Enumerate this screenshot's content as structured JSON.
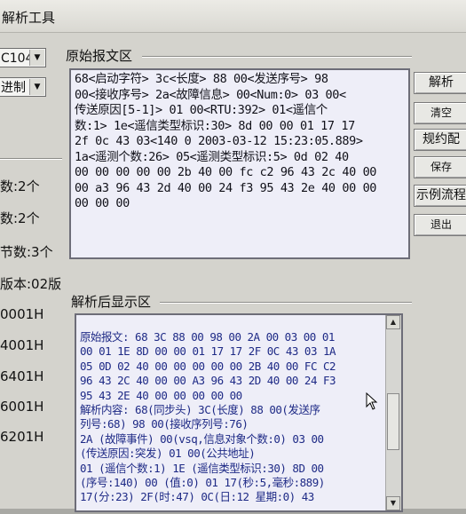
{
  "window": {
    "title": "解析工具"
  },
  "left": {
    "protocol_combo": "C104",
    "radix_combo": "进制",
    "info_lines": [
      "数:2个",
      "数:2个",
      "节数:3个",
      "版本:02版",
      "0001H",
      "4001H",
      "6401H",
      "6001H",
      "6201H"
    ]
  },
  "raw_section": {
    "label": "原始报文区",
    "text": "68<启动字符> 3c<长度> 88 00<发送序号> 98\n00<接收序号> 2a<故障信息> 00<Num:0> 03 00<\n传送原因[5-1]> 01 00<RTU:392> 01<遥信个\n数:1> 1e<遥信类型标识:30> 8d 00 00 01 17 17\n2f 0c 43 03<140 0 2003-03-12 15:23:05.889>\n1a<遥测个数:26> 05<遥测类型标识:5> 0d 02 40\n00 00 00 00 00 2b 40 00 fc c2 96 43 2c 40 00\n00 a3 96 43 2d 40 00 24 f3 95 43 2e 40 00 00\n00 00 00"
  },
  "parsed_section": {
    "label": "解析后显示区",
    "text": "原始报文: 68 3C 88 00 98 00 2A 00 03 00 01\n00 01 1E 8D 00 00 01 17 17 2F 0C 43 03 1A\n05 0D 02 40 00 00 00 00 00 2B 40 00 FC C2\n96 43 2C 40 00 00 A3 96 43 2D 40 00 24 F3\n95 43 2E 40 00 00 00 00 00\n解析内容: 68(同步头) 3C(长度) 88 00(发送序\n列号:68) 98 00(接收序列号:76)\n2A (故障事件) 00(vsq,信息对象个数:0) 03 00\n(传送原因:突发) 01 00(公共地址)\n01 (遥信个数:1) 1E (遥信类型标识:30) 8D 00\n(序号:140) 00 (值:0) 01 17(秒:5,毫秒:889)\n17(分:23) 2F(时:47) 0C(日:12 星期:0) 43"
  },
  "buttons": [
    "解析",
    "清空",
    "规约配",
    "保存",
    "示例流程",
    "退出"
  ]
}
